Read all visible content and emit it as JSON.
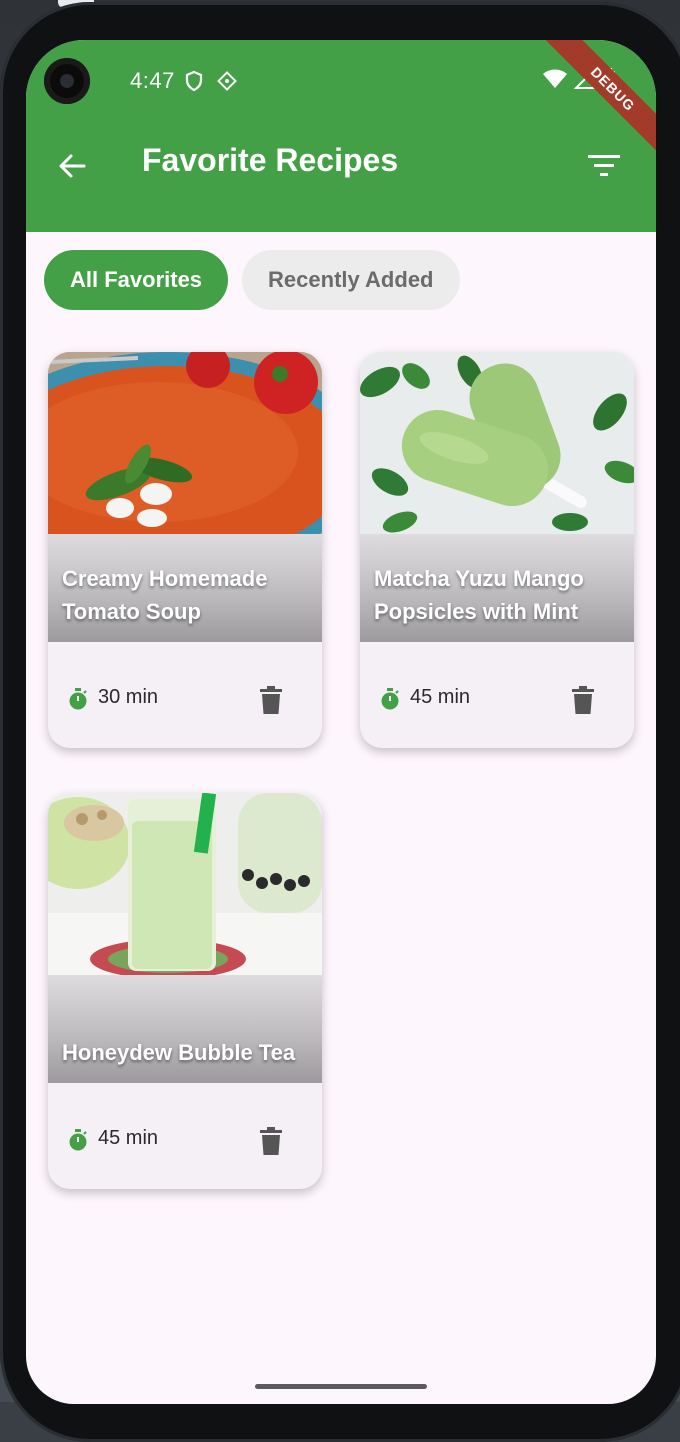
{
  "status_bar": {
    "time": "4:47"
  },
  "debug_banner": "DEBUG",
  "app_bar": {
    "title": "Favorite Recipes"
  },
  "filters": [
    {
      "label": "All Favorites",
      "selected": true
    },
    {
      "label": "Recently Added",
      "selected": false
    }
  ],
  "recipes": [
    {
      "title": "Creamy Homemade Tomato Soup",
      "time": "30 min",
      "image": "tomato-soup"
    },
    {
      "title": "Matcha Yuzu Mango Popsicles with Mint",
      "time": "45 min",
      "image": "matcha-popsicles"
    },
    {
      "title": "Honeydew Bubble Tea",
      "time": "45 min",
      "image": "honeydew-bubble-tea"
    }
  ],
  "colors": {
    "primary": "#43a047",
    "background": "#fdf6fc",
    "chip_inactive": "#ececec",
    "delete_icon": "#555555"
  }
}
